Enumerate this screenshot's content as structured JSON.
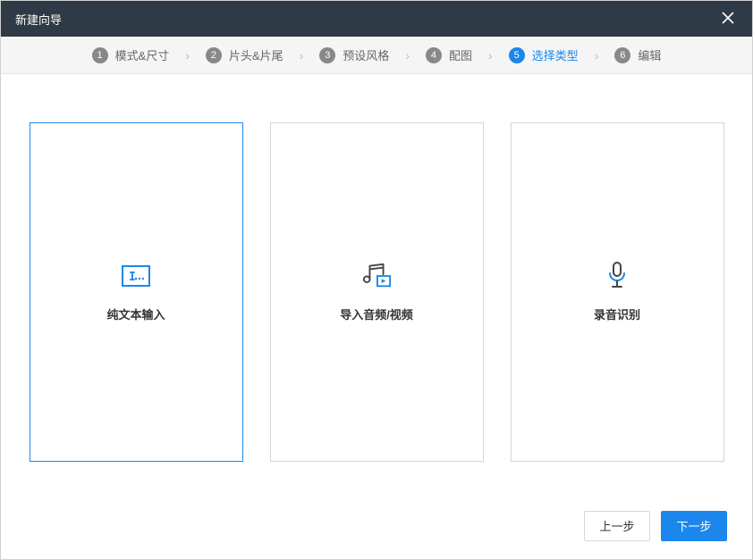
{
  "titlebar": {
    "title": "新建向导"
  },
  "steps": {
    "items": [
      {
        "num": "1",
        "label": "模式&尺寸"
      },
      {
        "num": "2",
        "label": "片头&片尾"
      },
      {
        "num": "3",
        "label": "预设风格"
      },
      {
        "num": "4",
        "label": "配图"
      },
      {
        "num": "5",
        "label": "选择类型"
      },
      {
        "num": "6",
        "label": "编辑"
      }
    ]
  },
  "cards": {
    "text": {
      "label": "纯文本输入"
    },
    "import": {
      "label": "导入音频/视频"
    },
    "record": {
      "label": "录音识别"
    }
  },
  "footer": {
    "prev": "上一步",
    "next": "下一步"
  }
}
